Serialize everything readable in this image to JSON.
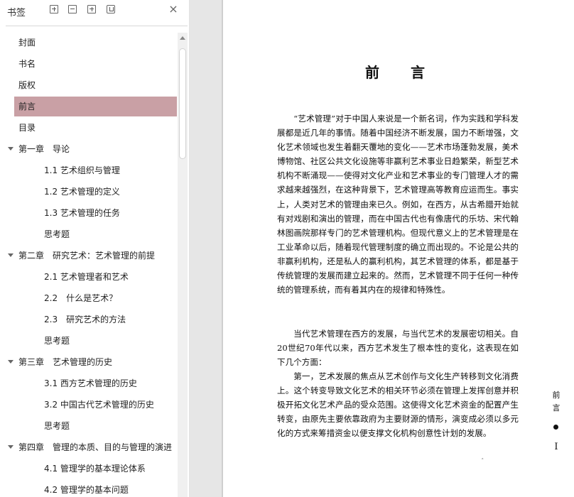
{
  "panel": {
    "title": "书签",
    "close_glyph": "×",
    "tools": [
      "expand-all-icon",
      "collapse-all-icon",
      "add-bookmark-icon",
      "bookmark-tag-icon"
    ]
  },
  "bookmarks": [
    {
      "label": "封面",
      "level": 0
    },
    {
      "label": "书名",
      "level": 0
    },
    {
      "label": "版权",
      "level": 0
    },
    {
      "label": "前言",
      "level": 0,
      "selected": true
    },
    {
      "label": "目录",
      "level": 0
    },
    {
      "label": "第一章　导论",
      "level": 0,
      "expanded": true
    },
    {
      "label": "1.1  艺术组织与管理",
      "level": 1
    },
    {
      "label": "1.2  艺术管理的定义",
      "level": 1
    },
    {
      "label": "1.3  艺术管理的任务",
      "level": 1
    },
    {
      "label": "思考题",
      "level": 1
    },
    {
      "label": "第二章　研究艺术：艺术管理的前提",
      "level": 0,
      "expanded": true
    },
    {
      "label": "2.1  艺术管理者和艺术",
      "level": 1
    },
    {
      "label": "2.2　什么是艺术？",
      "level": 1
    },
    {
      "label": "2.3　研究艺术的方法",
      "level": 1
    },
    {
      "label": "思考题",
      "level": 1
    },
    {
      "label": "第三章　艺术管理的历史",
      "level": 0,
      "expanded": true
    },
    {
      "label": "3.1  西方艺术管理的历史",
      "level": 1
    },
    {
      "label": "3.2  中国古代艺术管理的历史",
      "level": 1
    },
    {
      "label": "思考题",
      "level": 1
    },
    {
      "label": "第四章　管理的本质、目的与管理的演进",
      "level": 0,
      "expanded": true
    },
    {
      "label": "4.1  管理学的基本理论体系",
      "level": 1
    },
    {
      "label": "4.2  管理学的基本问题",
      "level": 1
    }
  ],
  "document": {
    "title": "前言",
    "paragraphs": [
      "“艺术管理”对于中国人来说是一个新名词，作为实践和学科发展都是近几年的事情。随着中国经济不断发展，国力不断增强，文化艺术领域也发生着翻天覆地的变化——艺术市场蓬勃发展，美术博物馆、社区公共文化设施等非赢利艺术事业日趋繁荣，新型艺术机构不断涌现——使得对文化产业和艺术事业的专门管理人才的需求越来越强烈，在这种背景下，艺术管理高等教育应运而生。事实上，人类对艺术的管理由来已久。例如，在西方，从古希腊开始就有对戏剧和演出的管理，而在中国古代也有像唐代的乐坊、宋代翰林图画院那样专门的艺术管理机构。但现代意义上的艺术管理是在工业革命以后，随着现代管理制度的确立而出现的。不论是公共的非赢利机构，还是私人的赢利机构，其艺术管理的体系，都是基于传统管理的发展而建立起来的。然而，艺术管理不同于任何一种传统的管理系统，而有着其内在的规律和特殊性。",
      "当代艺术管理在西方的发展，与当代艺术的发展密切相关。自20世纪70年代以来，西方艺术发生了根本性的变化，这表现在如下几个方面：",
      "第一，艺术发展的焦点从艺术创作与文化生产转移到文化消费上。这个转变导致文化艺术的相关环节必须在管理上发挥创意并积极开拓文化艺术产品的受众范围。这使得文化艺术资金的配置产生转变，由原先主要依靠政府为主要财源的情形，演变成必须以多元化的方式来筹措资金以便支撑文化机构创意性计划的发展。"
    ],
    "speck": "ﾞ",
    "side_label": [
      "前",
      "言"
    ],
    "page_number": "I"
  }
}
